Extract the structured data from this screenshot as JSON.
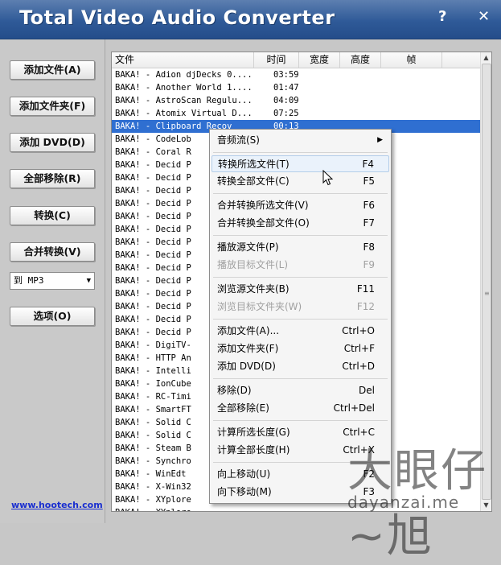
{
  "app": {
    "title": "Total Video Audio Converter",
    "help_label": "?",
    "close_label": "✕"
  },
  "sidebar": {
    "add_file": "添加文件(A)",
    "add_folder": "添加文件夹(F)",
    "add_dvd": "添加 DVD(D)",
    "remove_all": "全部移除(R)",
    "convert": "转换(C)",
    "merge_convert": "合并转换(V)",
    "format_value": "到 MP3",
    "options": "选项(O)",
    "website": "www.hootech.com"
  },
  "list": {
    "columns": {
      "file": "文件",
      "time": "时间",
      "width": "宽度",
      "height": "高度",
      "fps": "帧"
    },
    "rows": [
      {
        "name": "BAKA! - Adion djDecks 0....",
        "time": "03:59"
      },
      {
        "name": "BAKA! - Another World 1....",
        "time": "01:47"
      },
      {
        "name": "BAKA! - AstroScan Regulu...",
        "time": "04:09"
      },
      {
        "name": "BAKA! - Atomix Virtual D...",
        "time": "07:25"
      },
      {
        "name": "BAKA! - Clipboard Recov",
        "time": "00:13"
      },
      {
        "name": "BAKA! - CodeLob",
        "time": ""
      },
      {
        "name": "BAKA! - Coral R",
        "time": ""
      },
      {
        "name": "BAKA! - Decid P",
        "time": ""
      },
      {
        "name": "BAKA! - Decid P",
        "time": ""
      },
      {
        "name": "BAKA! - Decid P",
        "time": ""
      },
      {
        "name": "BAKA! - Decid P",
        "time": ""
      },
      {
        "name": "BAKA! - Decid P",
        "time": ""
      },
      {
        "name": "BAKA! - Decid P",
        "time": ""
      },
      {
        "name": "BAKA! - Decid P",
        "time": ""
      },
      {
        "name": "BAKA! - Decid P",
        "time": ""
      },
      {
        "name": "BAKA! - Decid P",
        "time": ""
      },
      {
        "name": "BAKA! - Decid P",
        "time": ""
      },
      {
        "name": "BAKA! - Decid P",
        "time": ""
      },
      {
        "name": "BAKA! - Decid P",
        "time": ""
      },
      {
        "name": "BAKA! - Decid P",
        "time": ""
      },
      {
        "name": "BAKA! - Decid P",
        "time": ""
      },
      {
        "name": "BAKA! - DigiTV-",
        "time": ""
      },
      {
        "name": "BAKA! - HTTP An",
        "time": ""
      },
      {
        "name": "BAKA! - Intelli",
        "time": ""
      },
      {
        "name": "BAKA! - IonCube",
        "time": ""
      },
      {
        "name": "BAKA! - RC-Timi",
        "time": ""
      },
      {
        "name": "BAKA! - SmartFT",
        "time": ""
      },
      {
        "name": "BAKA! - Solid C",
        "time": ""
      },
      {
        "name": "BAKA! - Solid C",
        "time": ""
      },
      {
        "name": "BAKA! - Steam B",
        "time": ""
      },
      {
        "name": "BAKA! - Synchro",
        "time": ""
      },
      {
        "name": "BAKA! - WinEdt",
        "time": ""
      },
      {
        "name": "BAKA! - X-Win32",
        "time": ""
      },
      {
        "name": "BAKA! - XYplore",
        "time": ""
      },
      {
        "name": "BAKA! - XYplore",
        "time": ""
      }
    ]
  },
  "menu": {
    "audio_stream": "音频流(S)",
    "convert_selected": "转换所选文件(T)",
    "convert_selected_key": "F4",
    "convert_all": "转换全部文件(C)",
    "convert_all_key": "F5",
    "merge_selected": "合并转换所选文件(V)",
    "merge_selected_key": "F6",
    "merge_all": "合并转换全部文件(O)",
    "merge_all_key": "F7",
    "play_source": "播放源文件(P)",
    "play_source_key": "F8",
    "play_target": "播放目标文件(L)",
    "play_target_key": "F9",
    "browse_source": "浏览源文件夹(B)",
    "browse_source_key": "F11",
    "browse_target": "浏览目标文件夹(W)",
    "browse_target_key": "F12",
    "add_file": "添加文件(A)...",
    "add_file_key": "Ctrl+O",
    "add_folder": "添加文件夹(F)",
    "add_folder_key": "Ctrl+F",
    "add_dvd": "添加 DVD(D)",
    "add_dvd_key": "Ctrl+D",
    "remove": "移除(D)",
    "remove_key": "Del",
    "remove_all": "全部移除(E)",
    "remove_all_key": "Ctrl+Del",
    "calc_selected": "计算所选长度(G)",
    "calc_selected_key": "Ctrl+C",
    "calc_all": "计算全部长度(H)",
    "calc_all_key": "Ctrl+X",
    "move_up": "向上移动(U)",
    "move_up_key": "F2",
    "move_down": "向下移动(M)",
    "move_down_key": "F3"
  },
  "watermark": {
    "big": "大眼仔~旭",
    "small": "dayanzai.me"
  }
}
